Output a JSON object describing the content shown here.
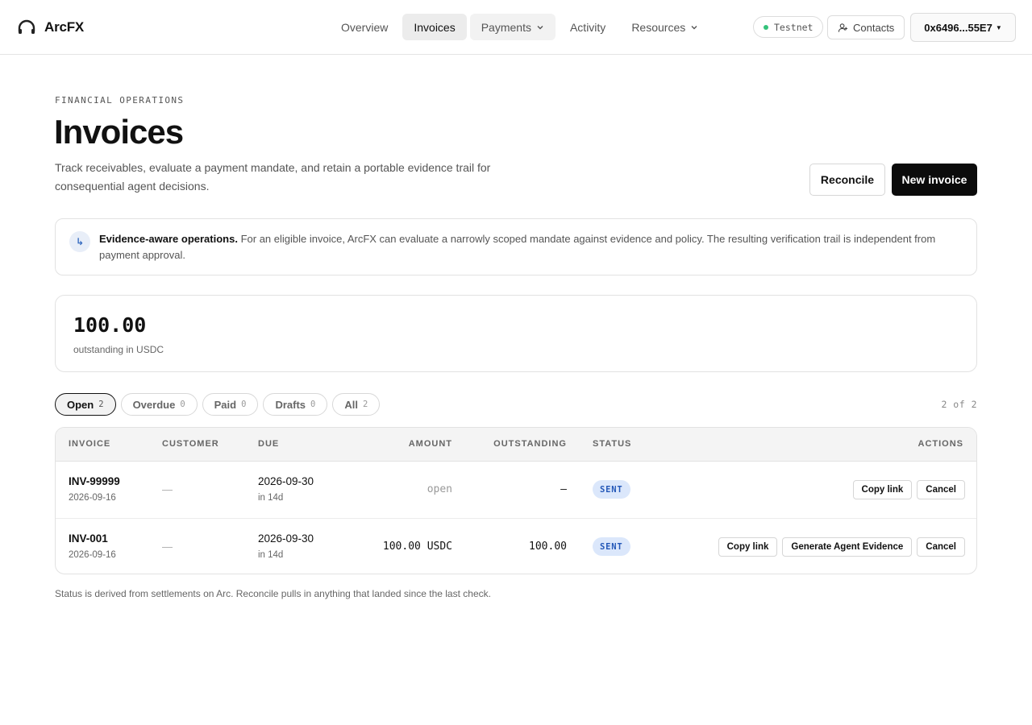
{
  "app": {
    "name": "ArcFX"
  },
  "nav": {
    "items": [
      {
        "label": "Overview"
      },
      {
        "label": "Invoices"
      },
      {
        "label": "Payments"
      },
      {
        "label": "Activity"
      },
      {
        "label": "Resources"
      }
    ]
  },
  "header": {
    "network": "Testnet",
    "contacts": "Contacts",
    "wallet": "0x6496...55E7"
  },
  "page": {
    "eyebrow": "FINANCIAL OPERATIONS",
    "title": "Invoices",
    "description": "Track receivables, evaluate a payment mandate, and retain a portable evidence trail for consequential agent decisions.",
    "reconcile": "Reconcile",
    "new_invoice": "New invoice"
  },
  "notice": {
    "title": "Evidence-aware operations.",
    "body": "For an eligible invoice, ArcFX can evaluate a narrowly scoped mandate against evidence and policy. The resulting verification trail is independent from payment approval."
  },
  "summary": {
    "value": "100.00",
    "label": "outstanding in USDC"
  },
  "filters": [
    {
      "label": "Open",
      "count": "2"
    },
    {
      "label": "Overdue",
      "count": "0"
    },
    {
      "label": "Paid",
      "count": "0"
    },
    {
      "label": "Drafts",
      "count": "0"
    },
    {
      "label": "All",
      "count": "2"
    }
  ],
  "range": "2 of 2",
  "table": {
    "columns": [
      "INVOICE",
      "CUSTOMER",
      "DUE",
      "AMOUNT",
      "OUTSTANDING",
      "STATUS",
      "ACTIONS"
    ],
    "rows": [
      {
        "id": "INV-99999",
        "created": "2026-09-16",
        "customer": "—",
        "due": "2026-09-30",
        "due_rel": "in 14d",
        "amount": "open",
        "outstanding": "—",
        "status": "SENT",
        "actions": [
          "Copy link",
          "Cancel"
        ]
      },
      {
        "id": "INV-001",
        "created": "2026-09-16",
        "customer": "—",
        "due": "2026-09-30",
        "due_rel": "in 14d",
        "amount": "100.00 USDC",
        "outstanding": "100.00",
        "status": "SENT",
        "actions": [
          "Copy link",
          "Generate Agent Evidence",
          "Cancel"
        ]
      }
    ]
  },
  "footnote": "Status is derived from settlements on Arc. Reconcile pulls in anything that landed since the last check.",
  "colors": {
    "accent": "#0b0b0b",
    "status_sent_bg": "#dbe7fb",
    "status_sent_fg": "#2458b8",
    "network_dot": "#34c27a"
  }
}
